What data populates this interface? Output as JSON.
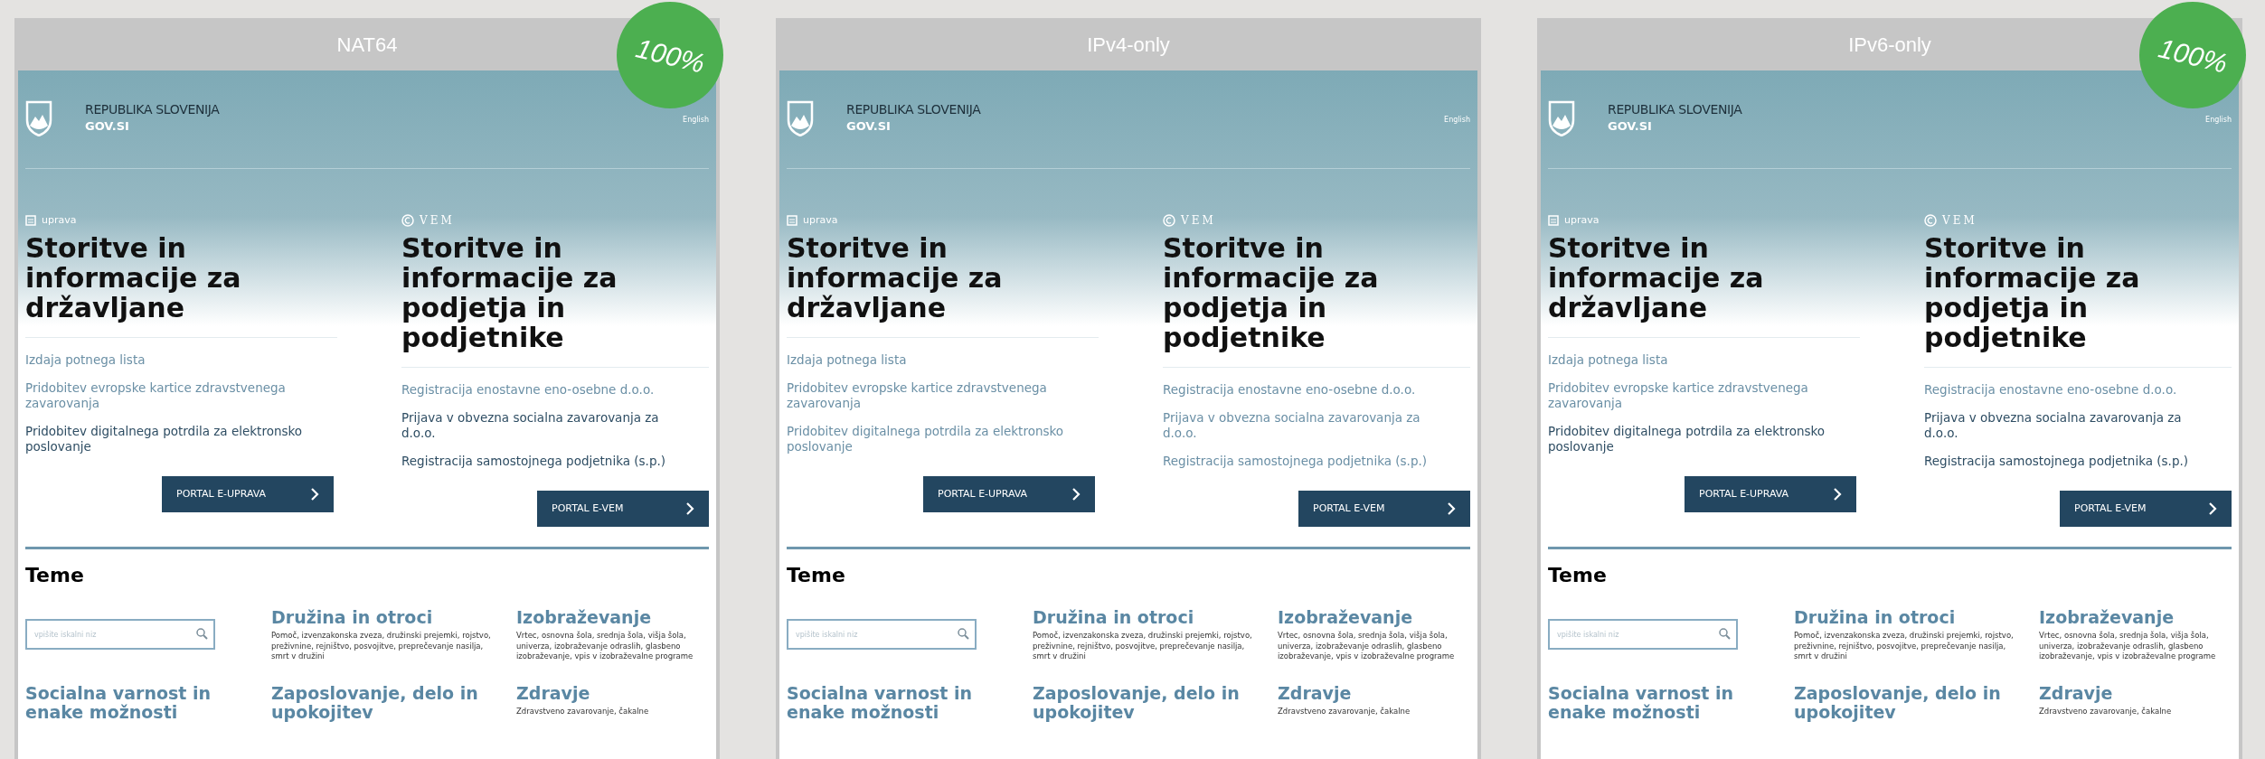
{
  "panels": [
    {
      "title": "NAT64",
      "badge": "100%",
      "page": {
        "site_name": "REPUBLIKA SLOVENIJA",
        "site_domain": "GOV.SI",
        "language_link": "English",
        "columns": [
          {
            "brand": "uprava",
            "kind": "square",
            "heading": "Storitve in informacije za državljane",
            "links": [
              {
                "text": "Izdaja potnega lista",
                "dim": true
              },
              {
                "text": "Pridobitev evropske kartice zdravstvenega zavarovanja",
                "dim": true
              },
              {
                "text": "Pridobitev digitalnega potrdila za elektronsko poslovanje",
                "dim": false
              }
            ],
            "button": "PORTAL E-UPRAVA"
          },
          {
            "brand": "VEM",
            "kind": "circle",
            "heading": "Storitve in informacije za podjetja in podjetnike",
            "links": [
              {
                "text": "Registracija enostavne eno-osebne d.o.o.",
                "dim": true
              },
              {
                "text": "Prijava v obvezna socialna zavarovanja za d.o.o.",
                "dim": false
              },
              {
                "text": "Registracija samostojnega podjetnika (s.p.)",
                "dim": false
              }
            ],
            "button": "PORTAL E-VEM"
          }
        ],
        "topics_heading": "Teme",
        "search_placeholder": "vpišite iskalni niz",
        "topics": [
          {
            "title": "Družina in otroci",
            "description": "Pomoč, izvenzakonska zveza, družinski prejemki, rojstvo, preživnine, rejništvo, posvojitve, preprečevanje nasilja, smrt v družini"
          },
          {
            "title": "Izobraževanje",
            "description": "Vrtec, osnovna šola, srednja šola, višja šola, univerza, izobraževanje odraslih, glasbeno izobraževanje, vpis v izobraževalne programe"
          },
          {
            "title": "Socialna varnost in enake možnosti"
          },
          {
            "title": "Zaposlovanje, delo in upokojitev"
          },
          {
            "title": "Zdravje",
            "description": "Zdravstveno zavarovanje, čakalne"
          }
        ]
      }
    },
    {
      "title": "IPv4-only",
      "page": {
        "site_name": "REPUBLIKA SLOVENIJA",
        "site_domain": "GOV.SI",
        "language_link": "English",
        "columns": [
          {
            "brand": "uprava",
            "kind": "square",
            "heading": "Storitve in informacije za državljane",
            "links": [
              {
                "text": "Izdaja potnega lista",
                "dim": true
              },
              {
                "text": "Pridobitev evropske kartice zdravstvenega zavarovanja",
                "dim": true
              },
              {
                "text": "Pridobitev digitalnega potrdila za elektronsko poslovanje",
                "dim": true
              }
            ],
            "button": "PORTAL E-UPRAVA"
          },
          {
            "brand": "VEM",
            "kind": "circle",
            "heading": "Storitve in informacije za podjetja in podjetnike",
            "links": [
              {
                "text": "Registracija enostavne eno-osebne d.o.o.",
                "dim": true
              },
              {
                "text": "Prijava v obvezna socialna zavarovanja za d.o.o.",
                "dim": true
              },
              {
                "text": "Registracija samostojnega podjetnika (s.p.)",
                "dim": true
              }
            ],
            "button": "PORTAL E-VEM"
          }
        ],
        "topics_heading": "Teme",
        "search_placeholder": "vpišite iskalni niz",
        "topics": [
          {
            "title": "Družina in otroci",
            "description": "Pomoč, izvenzakonska zveza, družinski prejemki, rojstvo, preživnine, rejništvo, posvojitve, preprečevanje nasilja, smrt v družini"
          },
          {
            "title": "Izobraževanje",
            "description": "Vrtec, osnovna šola, srednja šola, višja šola, univerza, izobraževanje odraslih, glasbeno izobraževanje, vpis v izobraževalne programe"
          },
          {
            "title": "Socialna varnost in enake možnosti"
          },
          {
            "title": "Zaposlovanje, delo in upokojitev"
          },
          {
            "title": "Zdravje",
            "description": "Zdravstveno zavarovanje, čakalne"
          }
        ]
      }
    },
    {
      "title": "IPv6-only",
      "badge": "100%",
      "page": {
        "site_name": "REPUBLIKA SLOVENIJA",
        "site_domain": "GOV.SI",
        "language_link": "English",
        "columns": [
          {
            "brand": "uprava",
            "kind": "square",
            "heading": "Storitve in informacije za državljane",
            "links": [
              {
                "text": "Izdaja potnega lista",
                "dim": true
              },
              {
                "text": "Pridobitev evropske kartice zdravstvenega zavarovanja",
                "dim": true
              },
              {
                "text": "Pridobitev digitalnega potrdila za elektronsko poslovanje",
                "dim": false
              }
            ],
            "button": "PORTAL E-UPRAVA"
          },
          {
            "brand": "VEM",
            "kind": "circle",
            "heading": "Storitve in informacije za podjetja in podjetnike",
            "links": [
              {
                "text": "Registracija enostavne eno-osebne d.o.o.",
                "dim": true
              },
              {
                "text": "Prijava v obvezna socialna zavarovanja za d.o.o.",
                "dim": false
              },
              {
                "text": "Registracija samostojnega podjetnika (s.p.)",
                "dim": false
              }
            ],
            "button": "PORTAL E-VEM"
          }
        ],
        "topics_heading": "Teme",
        "search_placeholder": "vpišite iskalni niz",
        "topics": [
          {
            "title": "Družina in otroci",
            "description": "Pomoč, izvenzakonska zveza, družinski prejemki, rojstvo, preživnine, rejništvo, posvojitve, preprečevanje nasilja, smrt v družini"
          },
          {
            "title": "Izobraževanje",
            "description": "Vrtec, osnovna šola, srednja šola, višja šola, univerza, izobraževanje odraslih, glasbeno izobraževanje, vpis v izobraževalne programe"
          },
          {
            "title": "Socialna varnost in enake možnosti"
          },
          {
            "title": "Zaposlovanje, delo in upokojitev"
          },
          {
            "title": "Zdravje",
            "description": "Zdravstveno zavarovanje, čakalne"
          }
        ]
      }
    }
  ]
}
